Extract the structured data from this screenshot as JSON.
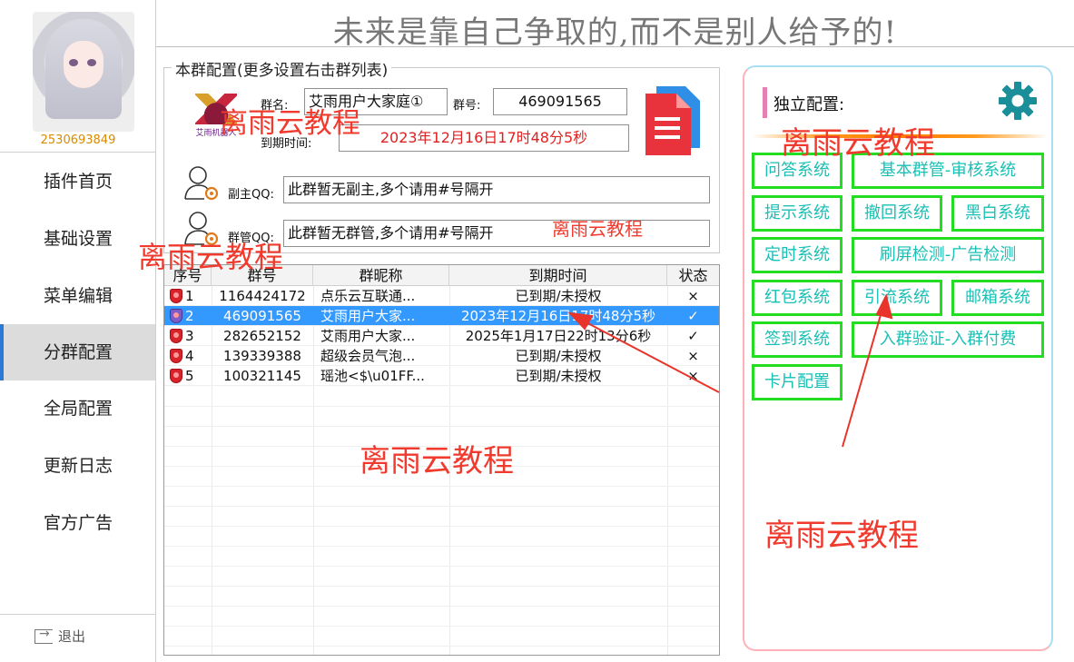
{
  "sidebar": {
    "qq_number": "2530693849",
    "items": [
      {
        "label": "插件首页"
      },
      {
        "label": "基础设置"
      },
      {
        "label": "菜单编辑"
      },
      {
        "label": "分群配置"
      },
      {
        "label": "全局配置"
      },
      {
        "label": "更新日志"
      },
      {
        "label": "官方广告"
      }
    ],
    "active_item": "分群配置",
    "logout_label": "退出"
  },
  "header": {
    "motto": "未来是靠自己争取的,而不是别人给予的!"
  },
  "group_config": {
    "legend": "本群配置(更多设置右击群列表)",
    "logo_text": "艾雨机器人",
    "group_name_label": "群名:",
    "group_name_value": "艾雨用户大家庭①",
    "group_id_label": "群号:",
    "group_id_value": "469091565",
    "expire_label": "到期时间:",
    "expire_value": "2023年12月16日17时48分5秒",
    "vice_owner_label": "副主QQ:",
    "vice_owner_value": "此群暂无副主,多个请用#号隔开",
    "admin_label": "群管QQ:",
    "admin_value": "此群暂无群管,多个请用#号隔开"
  },
  "group_table": {
    "columns": [
      "序号",
      "群号",
      "群昵称",
      "到期时间",
      "状态"
    ],
    "rows": [
      {
        "index": "1",
        "group_id": "1164424172",
        "nickname": "点乐云互联通...",
        "expire": "已到期/未授权",
        "status": "×"
      },
      {
        "index": "2",
        "group_id": "469091565",
        "nickname": "艾雨用户大家...",
        "expire": "2023年12月16日17时48分5秒",
        "status": "✓"
      },
      {
        "index": "3",
        "group_id": "282652152",
        "nickname": "艾雨用户大家...",
        "expire": "2025年1月17日22时13分6秒",
        "status": "✓"
      },
      {
        "index": "4",
        "group_id": "139339388",
        "nickname": "超级会员气泡...",
        "expire": "已到期/未授权",
        "status": "×"
      },
      {
        "index": "5",
        "group_id": "100321145",
        "nickname": "瑶池<$\\u01FF...",
        "expire": "已到期/未授权",
        "status": "×"
      }
    ],
    "selected_index": "2"
  },
  "right_panel": {
    "title": "独立配置:",
    "buttons": [
      "问答系统",
      "基本群管-审核系统",
      "提示系统",
      "撤回系统",
      "黑白系统",
      "定时系统",
      "刷屏检测-广告检测",
      "红包系统",
      "引流系统",
      "邮箱系统",
      "签到系统",
      "入群验证-入群付费",
      "卡片配置"
    ]
  },
  "watermarks": [
    "离雨云教程",
    "离雨云教程",
    "离雨云教程",
    "离雨云教程",
    "离雨云教程",
    "离雨云教程"
  ],
  "colors": {
    "accent_blue": "#3399ff",
    "button_border": "#22dd22",
    "button_text": "#19c0b5",
    "watermark": "#f03a2e",
    "qq_number": "#d98a00",
    "gear": "#1a8f9a"
  },
  "icons": {
    "file": "red-document-icon",
    "person": "person-gear-icon",
    "gear": "gear-icon",
    "logout": "logout-icon"
  }
}
